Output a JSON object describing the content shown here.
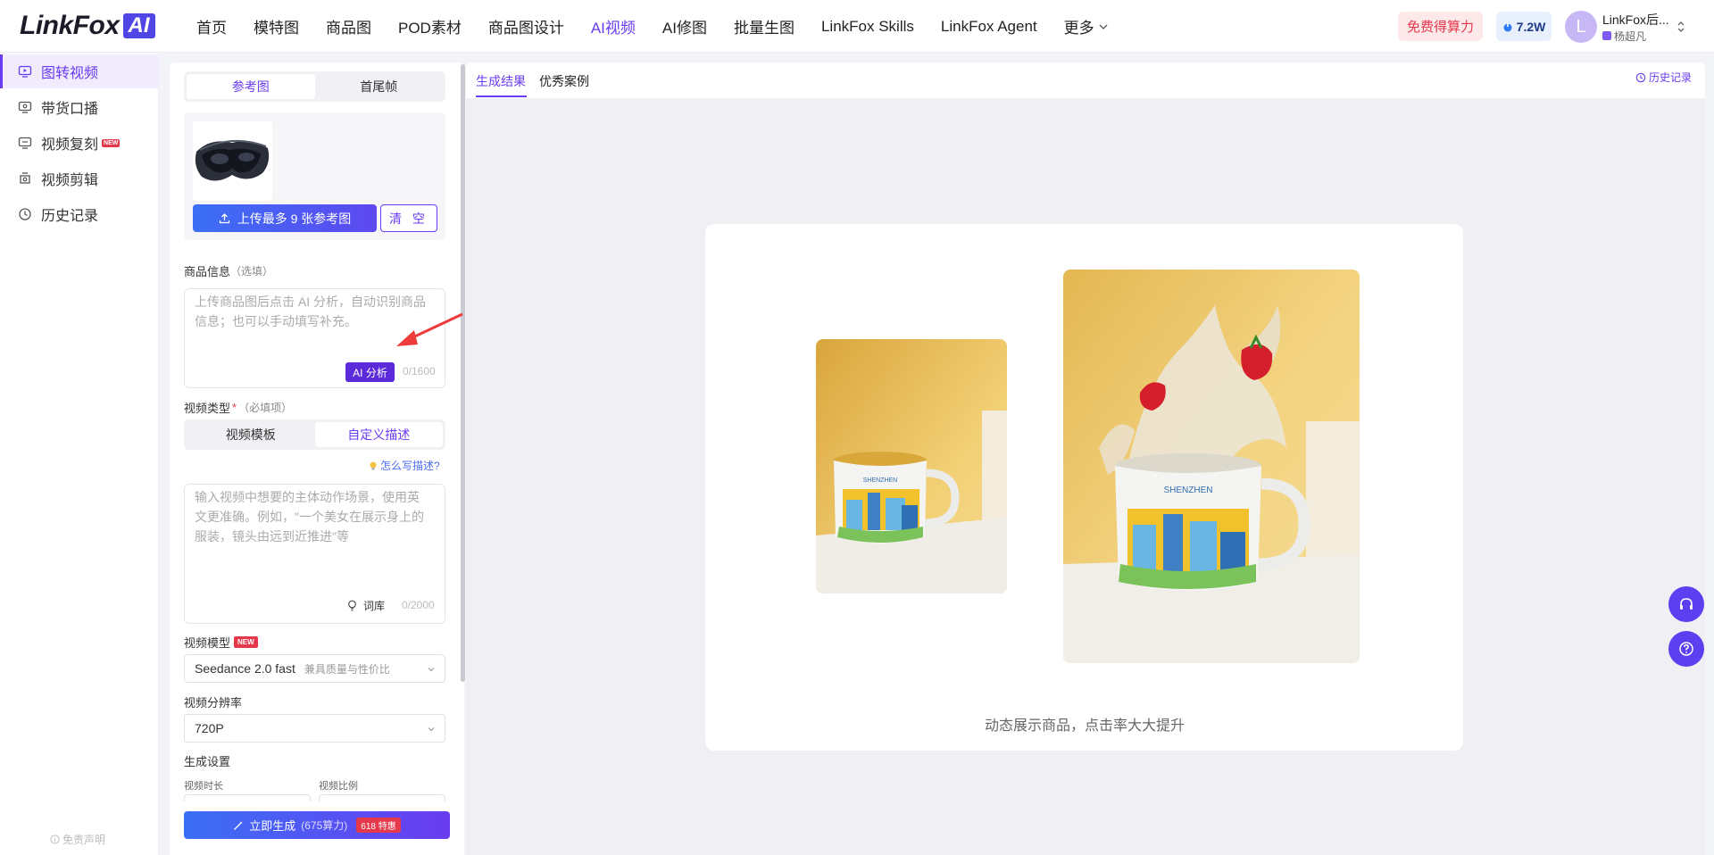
{
  "header": {
    "logo_text": "LinkFox",
    "logo_badge": "AI",
    "nav": [
      "首页",
      "模特图",
      "商品图",
      "POD素材",
      "商品图设计",
      "AI视频",
      "AI修图",
      "批量生图",
      "LinkFox Skills",
      "LinkFox Agent"
    ],
    "nav_active_index": 5,
    "nav_more": "更多",
    "free_credits": "免费得算力",
    "credits": "7.2W",
    "user_initial": "L",
    "user_name": "LinkFox后...",
    "user_sub": "杨超凡"
  },
  "sidebar": {
    "items": [
      {
        "label": "图转视频",
        "icon": "video-image-icon",
        "active": true
      },
      {
        "label": "带货口播",
        "icon": "broadcast-icon"
      },
      {
        "label": "视频复刻",
        "icon": "video-copy-icon",
        "badge": "NEW"
      },
      {
        "label": "视频剪辑",
        "icon": "video-edit-icon"
      },
      {
        "label": "历史记录",
        "icon": "history-icon"
      }
    ],
    "disclaimer": "免责声明"
  },
  "form": {
    "mode_tabs": [
      "参考图",
      "首尾帧"
    ],
    "upload_label": "上传最多 9 张参考图",
    "clear_label": "清 空",
    "product_info_label": "商品信息",
    "product_info_optional": "（选填）",
    "product_info_placeholder_1": "上传商品图后点击 AI 分析，自动识别商品",
    "product_info_placeholder_2": "信息；也可以手动填写补充。",
    "ai_analyze": "AI 分析",
    "product_counter": "0/1600",
    "video_type_label": "视频类型",
    "video_type_required_mark": "*",
    "video_type_required": "（必填项）",
    "video_type_tabs": [
      "视频模板",
      "自定义描述"
    ],
    "howto": "怎么写描述?",
    "desc_placeholder_1": "输入视频中想要的主体动作场景，使用英",
    "desc_placeholder_2": "文更准确。例如，\"一个美女在展示身上的",
    "desc_placeholder_3": "服装，镜头由远到近推进\"等",
    "lexicon": "词库",
    "desc_counter": "0/2000",
    "model_label": "视频模型",
    "model_badge": "NEW",
    "model_value": "Seedance 2.0 fast",
    "model_sub": "兼具质量与性价比",
    "resolution_label": "视频分辨率",
    "resolution_value": "720P",
    "gen_settings_label": "生成设置",
    "duration_label": "视频时长",
    "ratio_label": "视频比例",
    "generate_label": "立即生成",
    "generate_cost": "(675算力)",
    "generate_promo": "618 特惠"
  },
  "main": {
    "tabs": [
      "生成结果",
      "优秀案例"
    ],
    "history_link": "历史记录",
    "caption": "动态展示商品，点击率大大提升"
  },
  "colors": {
    "accent": "#6a3cf0",
    "promo_red": "#e5384b",
    "upload_blue": "#3b6ff5"
  }
}
